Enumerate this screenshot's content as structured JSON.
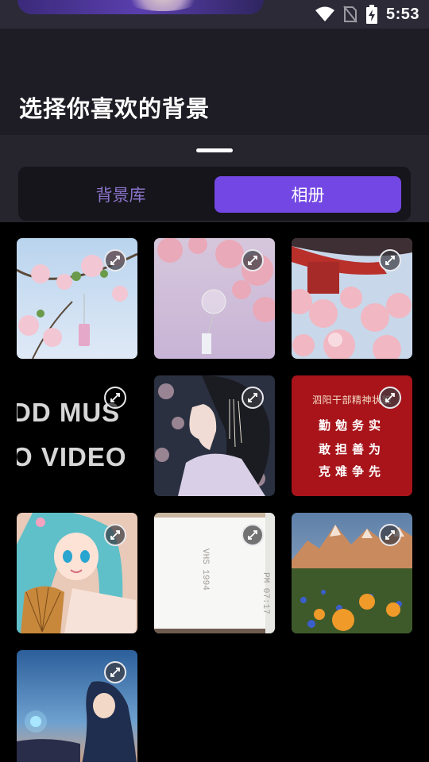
{
  "status_bar": {
    "time": "5:53",
    "icons": [
      "wifi-icon",
      "no-sim-icon",
      "battery-charging-icon"
    ]
  },
  "header": {
    "title": "选择你喜欢的背景"
  },
  "tabs": [
    {
      "label": "背景库",
      "selected": false
    },
    {
      "label": "相册",
      "selected": true
    }
  ],
  "colors": {
    "accent": "#7347e3",
    "tab_inactive": "#8a73c9",
    "header_bg": "#1e1c24",
    "sheet_bg": "#26242d"
  },
  "grid": {
    "items": [
      {
        "kind": "image",
        "subject": "cherry blossoms with wind chime, blue sky"
      },
      {
        "kind": "image",
        "subject": "cherry blossoms with glass wind chime, pink"
      },
      {
        "kind": "image",
        "subject": "red pagoda roof with cherry blossoms"
      },
      {
        "kind": "video-text",
        "lines": [
          "DD MUS",
          "O VIDEO"
        ]
      },
      {
        "kind": "image",
        "subject": "illustrated woman profile with headdress"
      },
      {
        "kind": "red-poster",
        "heading": "泗阳干部精神状貌",
        "lines": [
          "勤勉务实",
          "敢担善为",
          "克难争先"
        ]
      },
      {
        "kind": "image",
        "subject": "anime girl with teal hair holding fan"
      },
      {
        "kind": "vhs-scan",
        "texts": [
          "VHS 1994",
          "PM 07:17"
        ]
      },
      {
        "kind": "image",
        "subject": "snowy mountains with flower meadow"
      },
      {
        "kind": "image",
        "subject": "anime girl at dusk with glowing flower"
      }
    ],
    "expand_icon": "expand-icon"
  }
}
